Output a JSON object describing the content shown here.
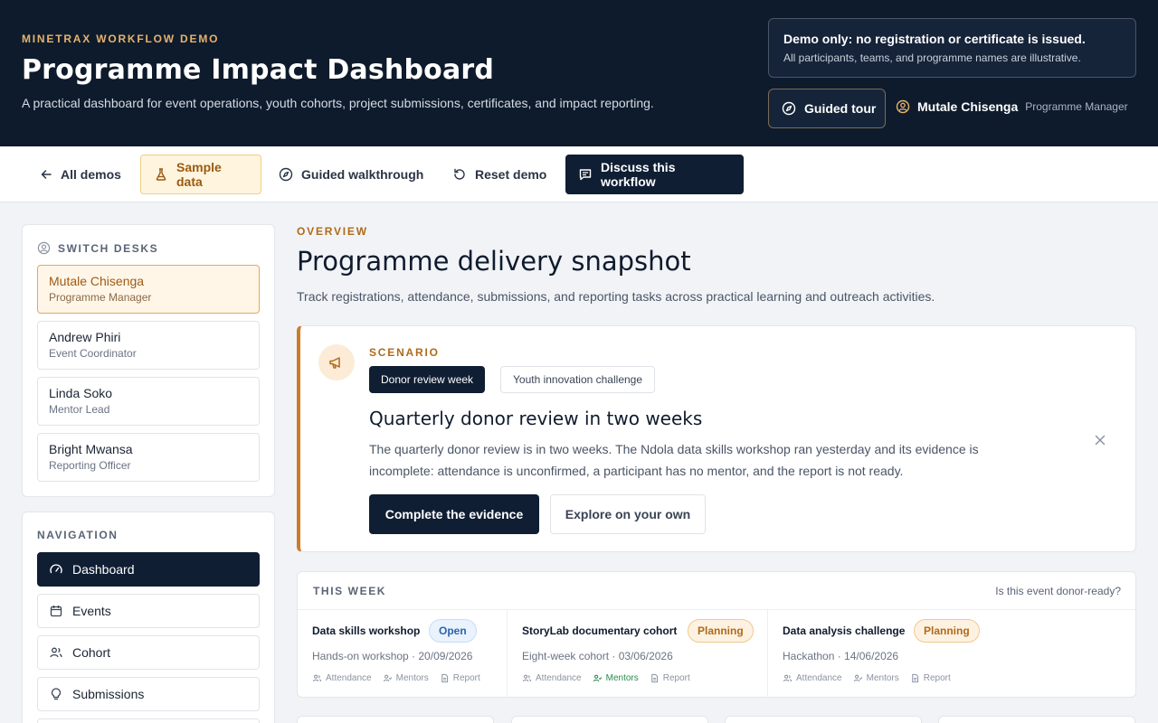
{
  "header": {
    "kicker": "MINETRAX WORKFLOW DEMO",
    "title": "Programme Impact Dashboard",
    "description": "A practical dashboard for event operations, youth cohorts, project submissions, certificates, and impact reporting.",
    "demo_notice_title": "Demo only: no registration or certificate is issued.",
    "demo_notice_sub": "All participants, teams, and programme names are illustrative.",
    "tour_label": "Guided tour",
    "user_name": "Mutale Chisenga",
    "user_role": "Programme Manager"
  },
  "toolbar": {
    "all_demos": "All demos",
    "sample_data": "Sample data",
    "walkthrough": "Guided walkthrough",
    "reset": "Reset demo",
    "discuss": "Discuss this workflow"
  },
  "switch_desks": {
    "label": "SWITCH DESKS",
    "desks": [
      {
        "name": "Mutale Chisenga",
        "role": "Programme Manager"
      },
      {
        "name": "Andrew Phiri",
        "role": "Event Coordinator"
      },
      {
        "name": "Linda Soko",
        "role": "Mentor Lead"
      },
      {
        "name": "Bright Mwansa",
        "role": "Reporting Officer"
      }
    ]
  },
  "navigation": {
    "label": "NAVIGATION",
    "items": [
      {
        "label": "Dashboard"
      },
      {
        "label": "Events"
      },
      {
        "label": "Cohort"
      },
      {
        "label": "Submissions"
      }
    ]
  },
  "overview": {
    "kicker": "OVERVIEW",
    "title": "Programme delivery snapshot",
    "description": "Track registrations, attendance, submissions, and reporting tasks across practical learning and outreach activities."
  },
  "scenario": {
    "kicker": "SCENARIO",
    "chips": [
      "Donor review week",
      "Youth innovation challenge"
    ],
    "title": "Quarterly donor review in two weeks",
    "body": "The quarterly donor review is in two weeks. The Ndola data skills workshop ran yesterday and its evidence is incomplete: attendance is unconfirmed, a participant has no mentor, and the report is not ready.",
    "primary": "Complete the evidence",
    "secondary": "Explore on your own"
  },
  "this_week": {
    "label": "THIS WEEK",
    "question": "Is this event donor-ready?",
    "events": [
      {
        "title": "Data skills workshop",
        "status": "Open",
        "meta": "Hands-on workshop · 20/09/2026",
        "tags": [
          "Attendance",
          "Mentors",
          "Report"
        ]
      },
      {
        "title": "StoryLab documentary cohort",
        "status": "Planning",
        "meta": "Eight-week cohort · 03/06/2026",
        "tags": [
          "Attendance",
          "Mentors",
          "Report"
        ]
      },
      {
        "title": "Data analysis challenge",
        "status": "Planning",
        "meta": "Hackathon · 14/06/2026",
        "tags": [
          "Attendance",
          "Mentors",
          "Report"
        ]
      }
    ]
  },
  "colors": {
    "header_bg": "#0e1b2c",
    "accent": "#cf7a2a",
    "primary": "#0f1e33",
    "success": "#2a8a4e"
  }
}
